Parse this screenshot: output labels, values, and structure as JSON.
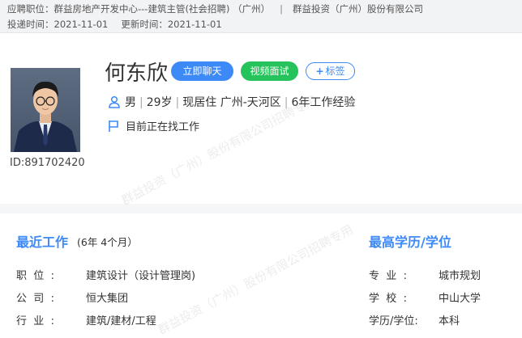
{
  "header": {
    "position_label": "应聘职位：",
    "position_value": "群益房地产开发中心---建筑主管(社会招聘) （广州）",
    "separator": "|",
    "company": "群益投资（广州）股份有限公司",
    "deliver_label": "投递时间：",
    "deliver_time": "2021-11-01",
    "update_label": "更新时间：",
    "update_time": "2021-11-01"
  },
  "candidate": {
    "name": "何东欣",
    "id_text": "ID:891702420",
    "gender": "男",
    "age": "29岁",
    "residence": "现居住 广州-天河区",
    "experience": "6年工作经验",
    "job_status": "目前正在找工作"
  },
  "actions": {
    "chat_label": "立即聊天",
    "video_label": "视频面试",
    "tag_plus": "+",
    "tag_label": "标签"
  },
  "recent_work": {
    "title": "最近工作",
    "duration": "(6年 4个月）",
    "rows": [
      {
        "label": "职位:",
        "value": "建筑设计（设计管理岗)"
      },
      {
        "label": "公司:",
        "value": "恒大集团"
      },
      {
        "label": "行业:",
        "value": "建筑/建材/工程"
      }
    ]
  },
  "education": {
    "title": "最高学历/学位",
    "rows": [
      {
        "label": "专业:",
        "value": "城市规划"
      },
      {
        "label": "学校:",
        "value": "中山大学"
      },
      {
        "label": "学历/学位:",
        "value": "本科"
      }
    ]
  },
  "watermark": {
    "text1": "群益投资（广州）股份有限公司招聘专用",
    "text2": "群益投资（广州）股份有限公司招聘专用"
  },
  "colors": {
    "accent": "#3d8af7",
    "video_green": "#26c25b"
  }
}
